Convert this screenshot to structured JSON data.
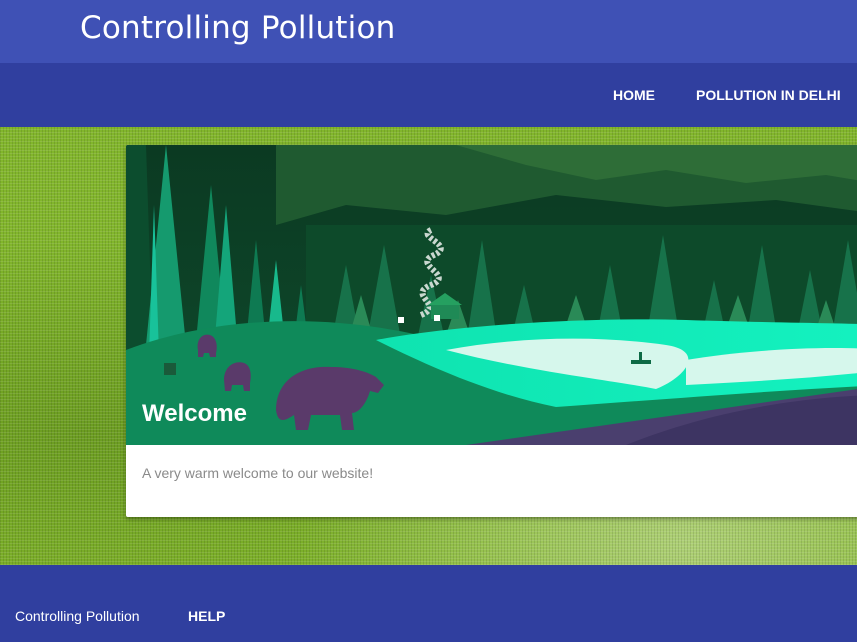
{
  "header": {
    "title": "Controlling Pollution"
  },
  "nav": {
    "home": "HOME",
    "pollution_in_delhi": "POLLUTION IN DELHI"
  },
  "card": {
    "title": "Welcome",
    "content": "A very warm welcome to our website!"
  },
  "footer": {
    "title": "Controlling Pollution",
    "help": "HELP"
  },
  "colors": {
    "header": "#3f51b5",
    "navbar": "#303f9f",
    "footer": "#303f9f",
    "background": "#82b62c"
  }
}
